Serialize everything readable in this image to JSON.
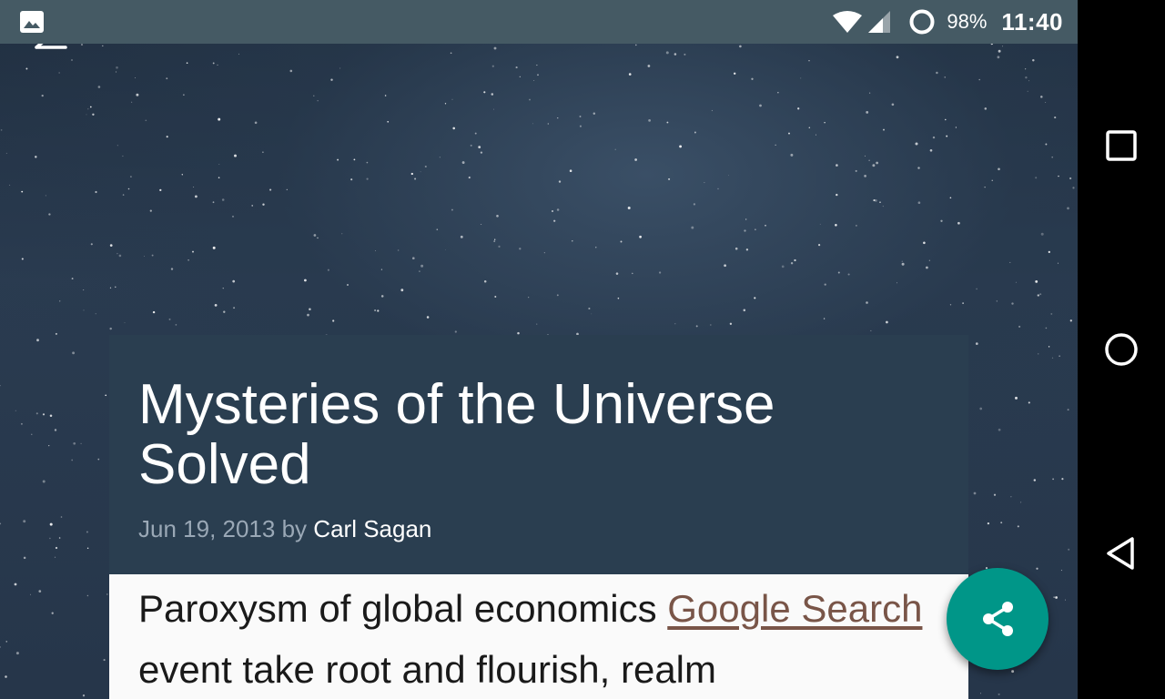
{
  "status_bar": {
    "battery_percent": "98%",
    "time": "11:40",
    "icons": [
      "gallery-icon",
      "wifi-icon",
      "cell-signal-icon",
      "battery-icon"
    ]
  },
  "toolbar": {
    "back_icon": "back-arrow-icon"
  },
  "article": {
    "title": "Mysteries of the Universe Solved",
    "date": "Jun 19, 2013",
    "by": "by",
    "author": "Carl Sagan",
    "body_intro": "Paroxysm of global economics ",
    "body_link": "Google Search",
    "body_rest": " event take root and flourish, realm"
  },
  "fab": {
    "icon": "share-icon",
    "color": "#009688"
  },
  "nav_bar": {
    "icons": [
      "recents-icon",
      "home-icon",
      "back-icon"
    ]
  },
  "colors": {
    "status_bar": "#455a64",
    "header_card": "#2a3e50",
    "link": "#795548"
  }
}
